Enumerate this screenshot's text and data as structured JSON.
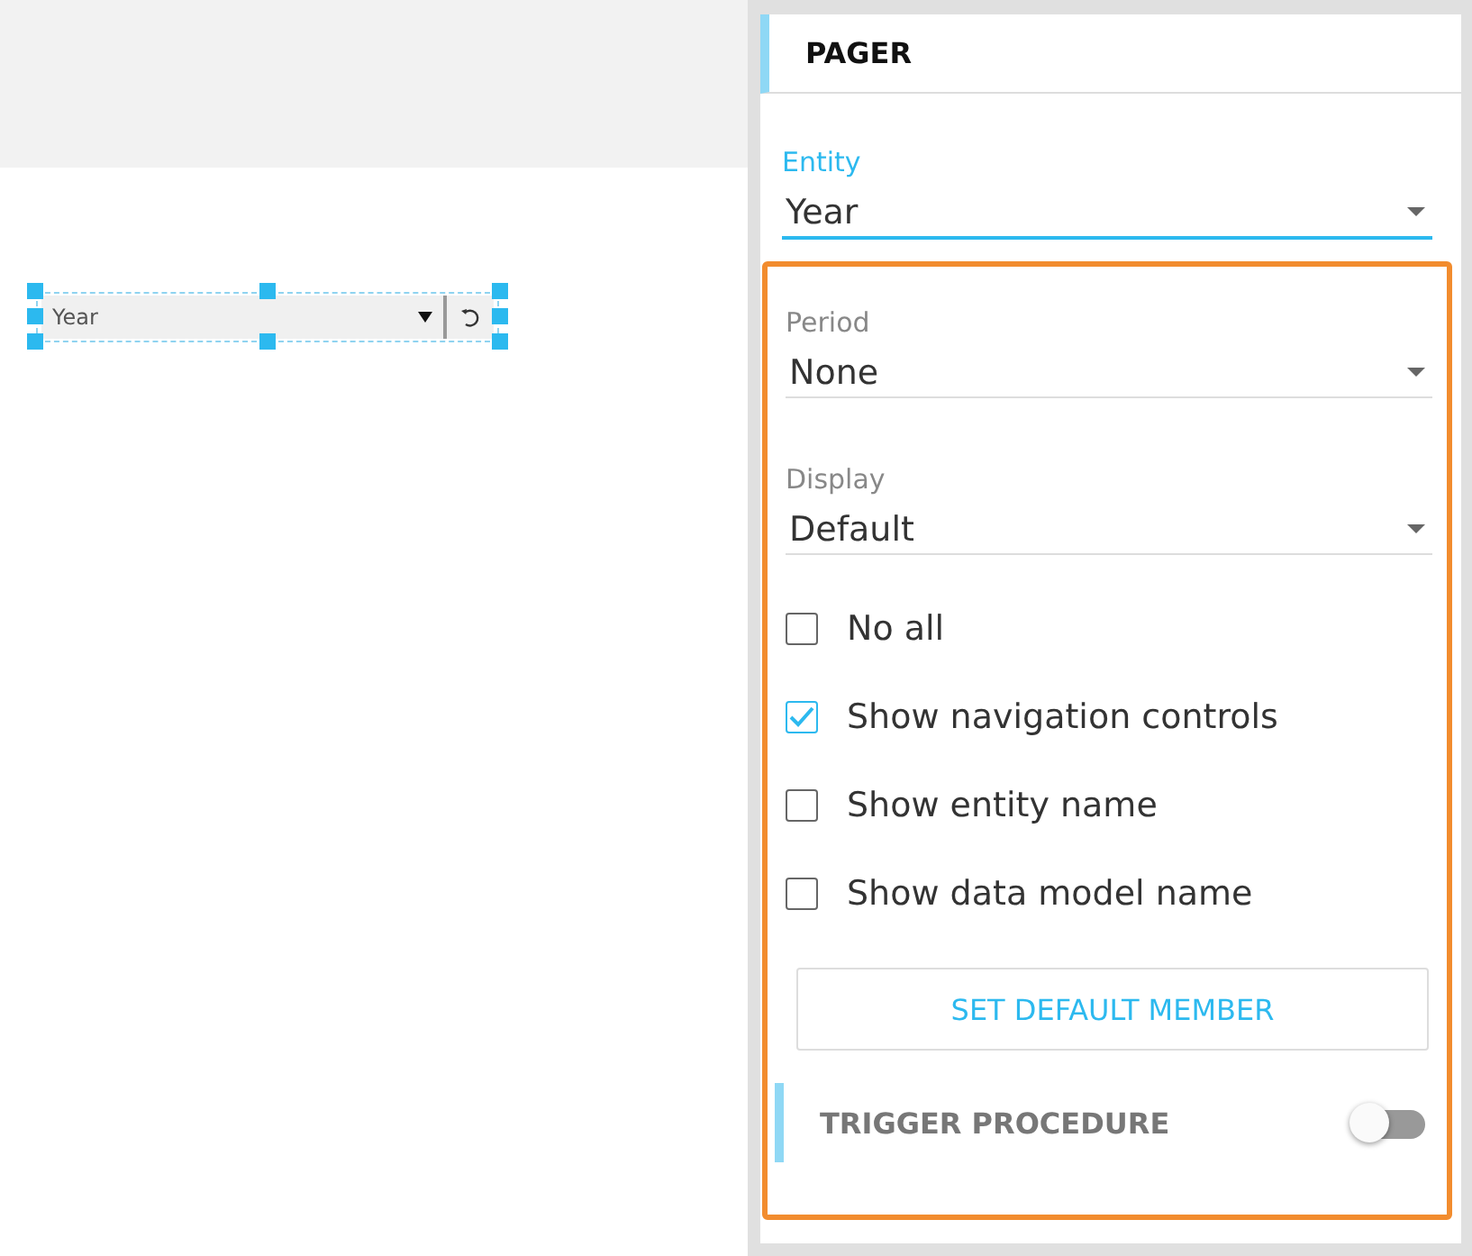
{
  "canvas": {
    "widget": {
      "value": "Year",
      "selected": true
    }
  },
  "panel": {
    "title": "PAGER",
    "entity": {
      "label": "Entity",
      "value": "Year",
      "focused": true
    },
    "section": {
      "highlighted": true,
      "fields": [
        {
          "label": "Period",
          "value": "None",
          "focused": false
        },
        {
          "label": "Display",
          "value": "Default",
          "focused": false
        }
      ],
      "options": [
        {
          "label": "No all",
          "checked": false
        },
        {
          "label": "Show navigation controls",
          "checked": true
        },
        {
          "label": "Show entity name",
          "checked": false
        },
        {
          "label": "Show data model name",
          "checked": false
        }
      ],
      "default_button": "SET DEFAULT MEMBER",
      "trigger": {
        "label": "TRIGGER PROCEDURE",
        "on": false
      }
    }
  }
}
